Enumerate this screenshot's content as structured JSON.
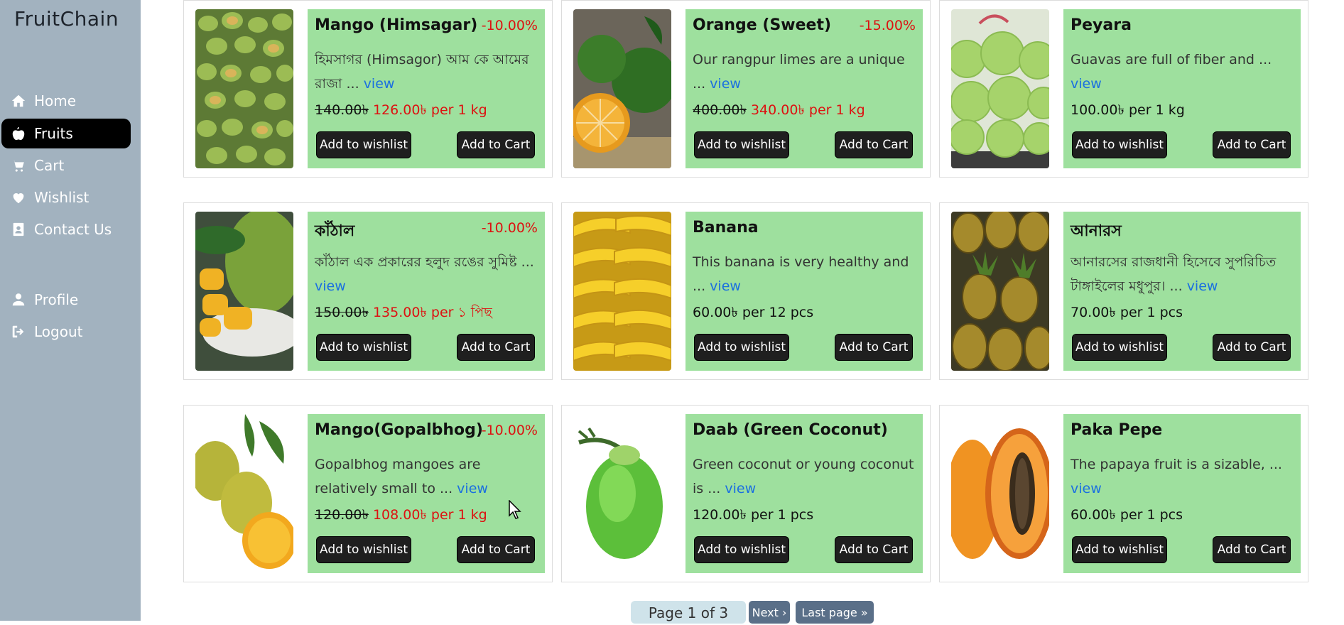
{
  "app": {
    "brand": "FruitChain"
  },
  "sidebar": {
    "items": [
      {
        "label": "Home",
        "icon": "home-icon",
        "active": false
      },
      {
        "label": "Fruits",
        "icon": "apple-icon",
        "active": true
      },
      {
        "label": "Cart",
        "icon": "cart-icon",
        "active": false
      },
      {
        "label": "Wishlist",
        "icon": "heart-icon",
        "active": false
      },
      {
        "label": "Contact Us",
        "icon": "contact-card-icon",
        "active": false
      },
      {
        "label": "Profile",
        "icon": "user-icon",
        "active": false
      },
      {
        "label": "Logout",
        "icon": "logout-icon",
        "active": false
      }
    ]
  },
  "products": [
    {
      "title": "Mango (Himsagar)",
      "discount": "-10.00%",
      "desc": "হিমসাগর (Himsagor) আম কে আমের রাজা ...",
      "view": "view",
      "old_price": "140.00৳",
      "new_price": "126.00৳ per 1 kg",
      "price": "",
      "wish": "Add to wishlist",
      "cart": "Add to Cart"
    },
    {
      "title": "Orange (Sweet)",
      "discount": "-15.00%",
      "desc": "Our rangpur limes are a unique ...",
      "view": "view",
      "old_price": "400.00৳",
      "new_price": "340.00৳ per 1 kg",
      "price": "",
      "wish": "Add to wishlist",
      "cart": "Add to Cart"
    },
    {
      "title": "Peyara",
      "discount": "",
      "desc": "Guavas are full of fiber and ...",
      "view": "view",
      "old_price": "",
      "new_price": "",
      "price": "100.00৳ per 1 kg",
      "wish": "Add to wishlist",
      "cart": "Add to Cart"
    },
    {
      "title": "কাঁঠাল",
      "discount": "-10.00%",
      "desc": "কাঁঠাল এক প্রকারের হলুদ রঙের সুমিষ্ট ...",
      "view": "view",
      "old_price": "150.00৳",
      "new_price": "135.00৳ per ১ পিছ",
      "price": "",
      "wish": "Add to wishlist",
      "cart": "Add to Cart"
    },
    {
      "title": "Banana",
      "discount": "",
      "desc": "This banana is very healthy and ...",
      "view": "view",
      "old_price": "",
      "new_price": "",
      "price": "60.00৳ per 12 pcs",
      "wish": "Add to wishlist",
      "cart": "Add to Cart"
    },
    {
      "title": "আনারস",
      "discount": "",
      "desc": "আনারসের রাজধানী হিসেবে সুপরিচিত টাঙ্গাইলের মধুপুর। ...",
      "view": "view",
      "old_price": "",
      "new_price": "",
      "price": "70.00৳ per 1 pcs",
      "wish": "Add to wishlist",
      "cart": "Add to Cart"
    },
    {
      "title": "Mango(Gopalbhog)",
      "discount": "-10.00%",
      "desc": "Gopalbhog mangoes are relatively small to ...",
      "view": "view",
      "old_price": "120.00৳",
      "new_price": "108.00৳ per 1 kg",
      "price": "",
      "wish": "Add to wishlist",
      "cart": "Add to Cart"
    },
    {
      "title": "Daab (Green Coconut)",
      "discount": "",
      "desc": "Green coconut or young coconut is ...",
      "view": "view",
      "old_price": "",
      "new_price": "",
      "price": "120.00৳ per 1 pcs",
      "wish": "Add to wishlist",
      "cart": "Add to Cart"
    },
    {
      "title": "Paka Pepe",
      "discount": "",
      "desc": "The papaya fruit is a sizable, ...",
      "view": "view",
      "old_price": "",
      "new_price": "",
      "price": "60.00৳ per 1 pcs",
      "wish": "Add to wishlist",
      "cart": "Add to Cart"
    }
  ],
  "pagination": {
    "info": "Page 1 of 3",
    "next": "Next ›",
    "last": "Last page »"
  },
  "colors": {
    "sidebar_bg": "#a2b2bf",
    "card_body_bg": "#9ee09e",
    "discount_red": "#dd1111",
    "link_blue": "#1a6fe0"
  }
}
